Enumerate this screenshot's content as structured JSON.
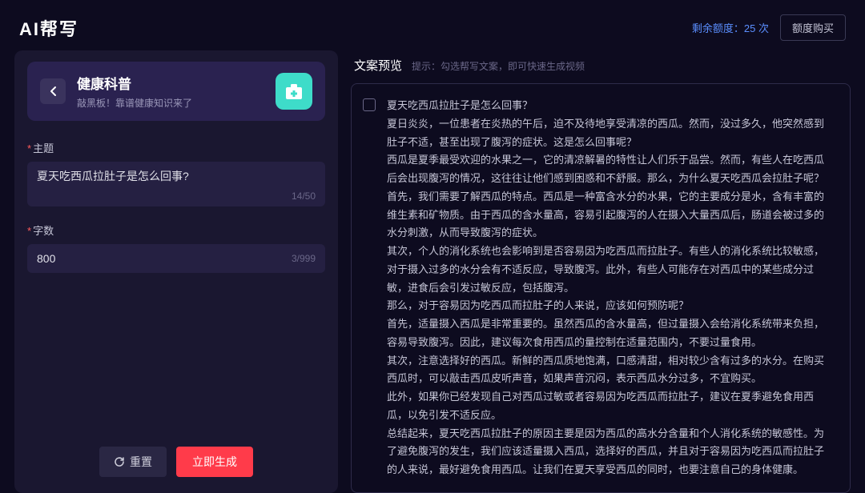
{
  "header": {
    "app_title": "AI帮写",
    "quota_label": "剩余额度：",
    "quota_value": "25 次",
    "buy_label": "额度购买"
  },
  "category": {
    "title": "健康科普",
    "subtitle": "敲黑板！靠谱健康知识来了"
  },
  "form": {
    "topic_label": "主题",
    "topic_value": "夏天吃西瓜拉肚子是怎么回事?",
    "topic_count": "14/50",
    "words_label": "字数",
    "words_value": "800",
    "words_limit": "3/999",
    "reset_label": "重置",
    "generate_label": "立即生成"
  },
  "preview": {
    "title": "文案预览",
    "hint_prefix": "提示：",
    "hint_text": "勾选帮写文案，即可快速生成视频",
    "content": "夏天吃西瓜拉肚子是怎么回事？\n夏日炎炎，一位患者在炎热的午后，迫不及待地享受清凉的西瓜。然而，没过多久，他突然感到肚子不适，甚至出现了腹泻的症状。这是怎么回事呢？\n西瓜是夏季最受欢迎的水果之一，它的清凉解暑的特性让人们乐于品尝。然而，有些人在吃西瓜后会出现腹泻的情况，这往往让他们感到困惑和不舒服。那么，为什么夏天吃西瓜会拉肚子呢？\n首先，我们需要了解西瓜的特点。西瓜是一种富含水分的水果，它的主要成分是水，含有丰富的维生素和矿物质。由于西瓜的含水量高，容易引起腹泻的人在摄入大量西瓜后，肠道会被过多的水分刺激，从而导致腹泻的症状。\n其次，个人的消化系统也会影响到是否容易因为吃西瓜而拉肚子。有些人的消化系统比较敏感，对于摄入过多的水分会有不适反应，导致腹泻。此外，有些人可能存在对西瓜中的某些成分过敏，进食后会引发过敏反应，包括腹泻。\n那么，对于容易因为吃西瓜而拉肚子的人来说，应该如何预防呢？\n首先，适量摄入西瓜是非常重要的。虽然西瓜的含水量高，但过量摄入会给消化系统带来负担，容易导致腹泻。因此，建议每次食用西瓜的量控制在适量范围内，不要过量食用。\n其次，注意选择好的西瓜。新鲜的西瓜质地饱满，口感清甜，相对较少含有过多的水分。在购买西瓜时，可以敲击西瓜皮听声音，如果声音沉闷，表示西瓜水分过多，不宜购买。\n此外，如果你已经发现自己对西瓜过敏或者容易因为吃西瓜而拉肚子，建议在夏季避免食用西瓜，以免引发不适反应。\n总结起来，夏天吃西瓜拉肚子的原因主要是因为西瓜的高水分含量和个人消化系统的敏感性。为了避免腹泻的发生，我们应该适量摄入西瓜，选择好的西瓜，并且对于容易因为吃西瓜而拉肚子的人来说，最好避免食用西瓜。让我们在夏天享受西瓜的同时，也要注意自己的身体健康。"
  }
}
